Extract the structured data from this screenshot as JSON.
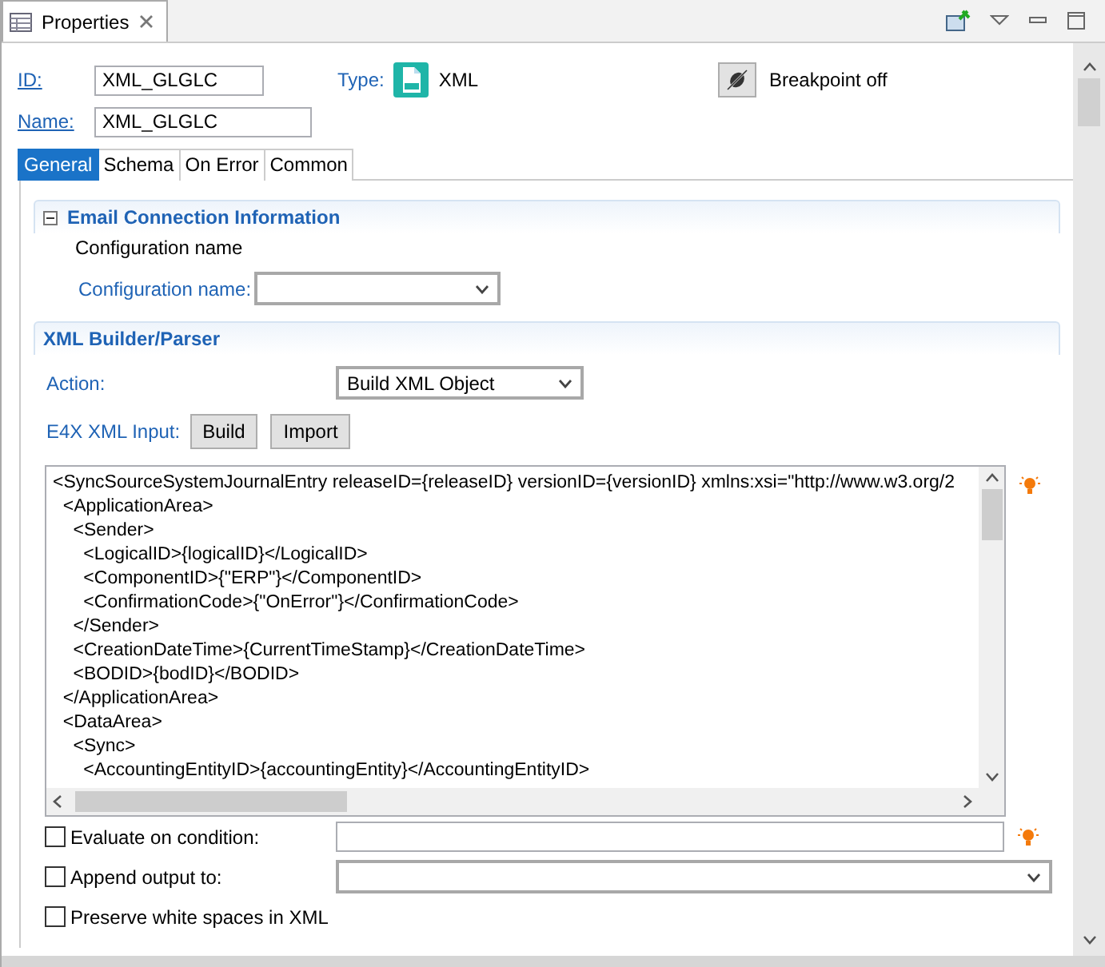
{
  "view_tab": {
    "title": "Properties"
  },
  "header": {
    "id_label": "ID:",
    "id_value": "XML_GLGLC",
    "name_label": "Name:",
    "name_value": "XML_GLGLC",
    "type_label": "Type:",
    "type_value": "XML",
    "breakpoint": "Breakpoint off"
  },
  "tabs": [
    {
      "label": "General",
      "selected": true
    },
    {
      "label": "Schema",
      "selected": false
    },
    {
      "label": "On Error",
      "selected": false
    },
    {
      "label": "Common",
      "selected": false
    }
  ],
  "email_section": {
    "title": "Email Connection Information",
    "expanded": true,
    "caption": "Configuration name",
    "config_label": "Configuration name:"
  },
  "xml_section": {
    "title": "XML Builder/Parser",
    "action_label": "Action:",
    "action_value": "Build XML Object",
    "input_label": "E4X XML Input:",
    "buttons": [
      "Build",
      "Import"
    ],
    "editor_lines": [
      "<SyncSourceSystemJournalEntry releaseID={releaseID} versionID={versionID} xmlns:xsi=\"http://www.w3.org/2",
      "  <ApplicationArea>",
      "    <Sender>",
      "      <LogicalID>{logicalID}</LogicalID>",
      "      <ComponentID>{\"ERP\"}</ComponentID>",
      "      <ConfirmationCode>{\"OnError\"}</ConfirmationCode>",
      "    </Sender>",
      "    <CreationDateTime>{CurrentTimeStamp}</CreationDateTime>",
      "    <BODID>{bodID}</BODID>",
      "  </ApplicationArea>",
      "  <DataArea>",
      "    <Sync>",
      "      <AccountingEntityID>{accountingEntity}</AccountingEntityID>"
    ]
  },
  "options": [
    {
      "kind": "field",
      "label": "Evaluate on condition:",
      "checked": false
    },
    {
      "kind": "combo",
      "label": "Append output to:",
      "checked": false
    },
    {
      "kind": "plain",
      "label": "Preserve white spaces in XML",
      "checked": false
    }
  ]
}
